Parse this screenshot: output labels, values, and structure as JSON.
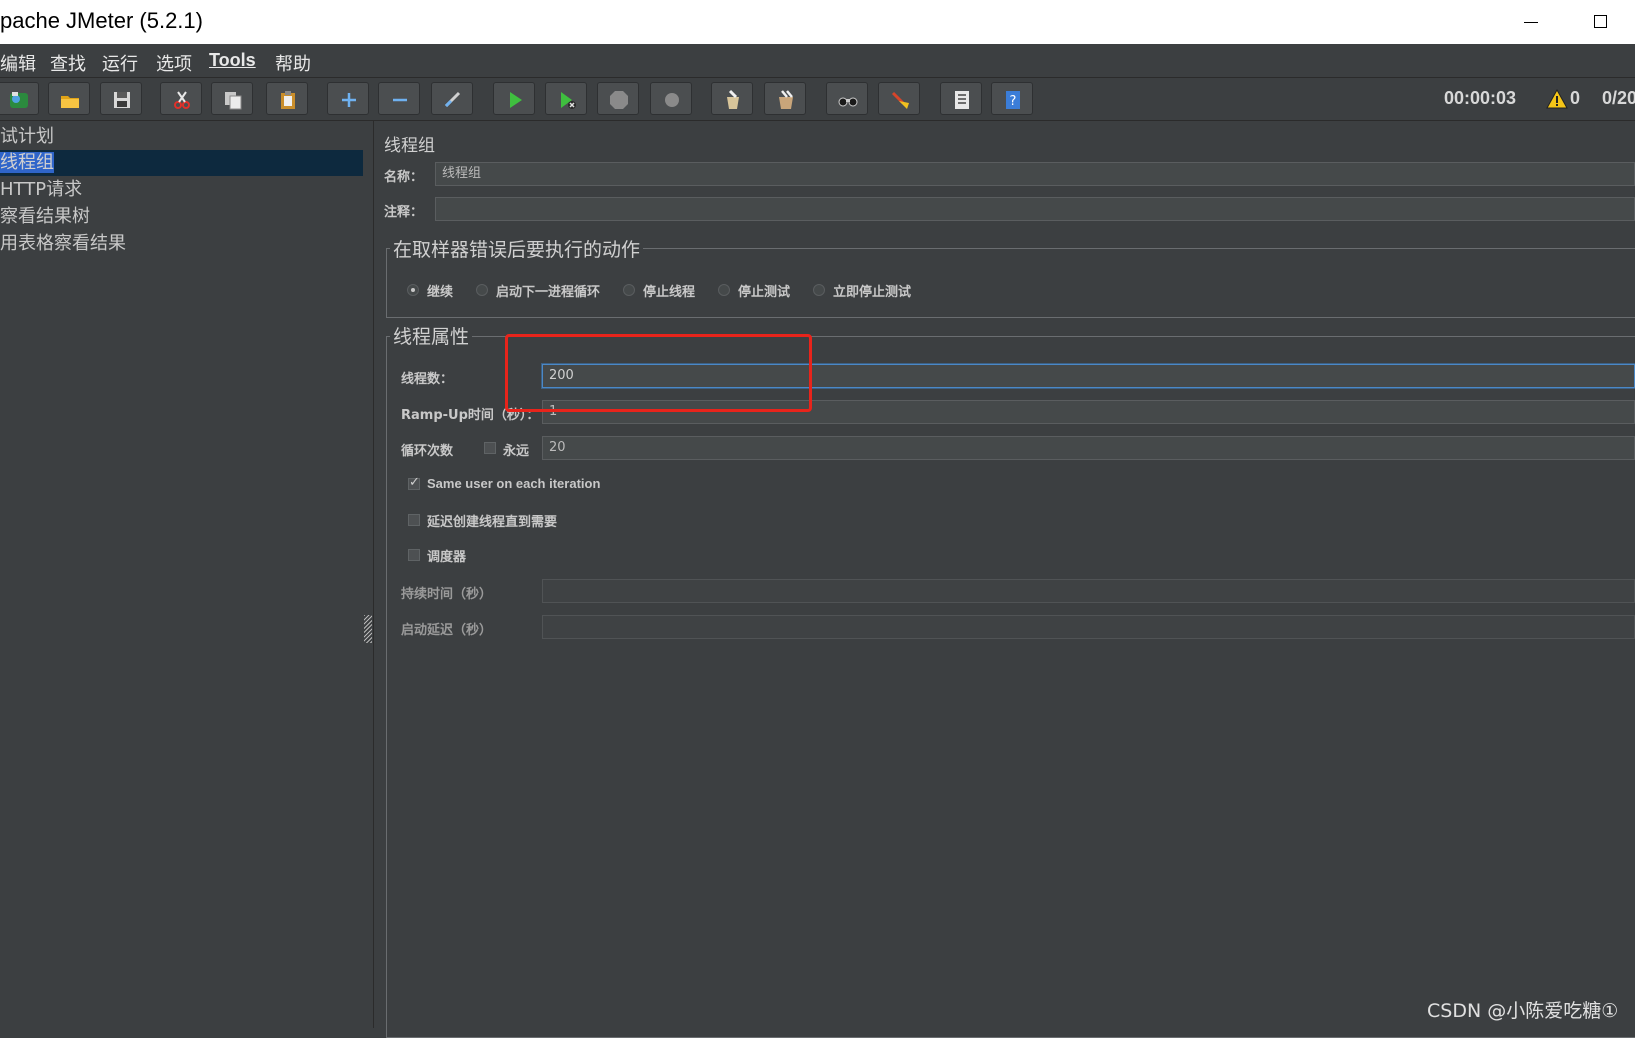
{
  "window": {
    "title": "pache JMeter (5.2.1)"
  },
  "menu": [
    {
      "label": "编辑"
    },
    {
      "label": "查找"
    },
    {
      "label": "运行"
    },
    {
      "label": "选项"
    },
    {
      "label": "Tools"
    },
    {
      "label": "帮助"
    }
  ],
  "status": {
    "timer": "00:00:03",
    "warnings": "0",
    "threads": "0/20"
  },
  "tree": [
    {
      "label": "试计划"
    },
    {
      "label": "线程组"
    },
    {
      "label": "HTTP请求"
    },
    {
      "label": "察看结果树"
    },
    {
      "label": "用表格察看结果"
    }
  ],
  "panel": {
    "title": "线程组",
    "name_label": "名称：",
    "name_value": "线程组",
    "comment_label": "注释：",
    "comment_value": "",
    "error_group": {
      "legend": "在取样器错误后要执行的动作",
      "options": [
        "继续",
        "启动下一进程循环",
        "停止线程",
        "停止测试",
        "立即停止测试"
      ],
      "selected": "继续"
    },
    "thread_group": {
      "legend": "线程属性",
      "threads_label": "线程数：",
      "threads_value": "200",
      "rampup_label": "Ramp-Up时间（秒）：",
      "rampup_value": "1",
      "loop_label": "循环次数",
      "forever_label": "永远",
      "forever_checked": false,
      "loop_value": "20",
      "same_user_label": "Same user on each iteration",
      "same_user_checked": true,
      "delay_label": "延迟创建线程直到需要",
      "delay_checked": false,
      "scheduler_label": "调度器",
      "scheduler_checked": false,
      "duration_label": "持续时间（秒）",
      "duration_value": "",
      "startup_label": "启动延迟（秒）",
      "startup_value": ""
    }
  },
  "watermark": "CSDN @小陈爱吃糖①",
  "colors": {
    "highlight_box": "#e8241b",
    "selection": "#2f65ca",
    "background": "#3c3f41"
  },
  "toolbar_icons": [
    "templates-icon",
    "open-icon",
    "save-icon",
    "cut-icon",
    "copy-icon",
    "paste-icon",
    "expand-icon",
    "collapse-icon",
    "toggle-icon",
    "start-icon",
    "start-no-pause-icon",
    "stop-icon",
    "shutdown-icon",
    "clear-icon",
    "clear-all-icon",
    "search-icon",
    "reset-search-icon",
    "function-helper-icon",
    "help-icon"
  ]
}
